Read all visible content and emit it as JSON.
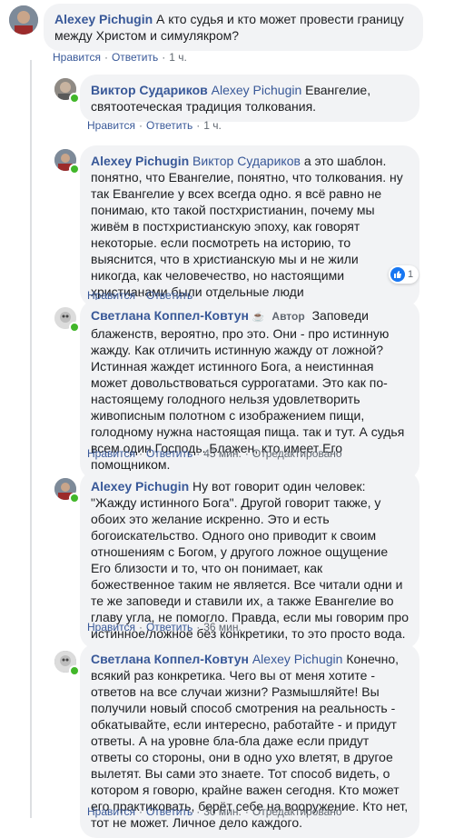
{
  "comments": [
    {
      "author": "Alexey Pichugin",
      "text": "А кто судья и кто может провести границу между Христом и симулякром?",
      "like": "Нравится",
      "reply": "Ответить",
      "time": "1 ч."
    },
    {
      "author": "Виктор Судариков",
      "mention": "Alexey Pichugin",
      "text": "Евангелие, святоотеческая традиция толкования.",
      "like": "Нравится",
      "reply": "Ответить",
      "time": "1 ч."
    },
    {
      "author": "Alexey Pichugin",
      "mention": "Виктор Судариков",
      "text": "а это шаблон. понятно, что Евангелие, понятно, что толкования. ну так Евангелие у всех всегда одно. я всё равно не понимаю, кто такой постхристианин, почему мы живём в постхристианскую эпоху, как говорят некоторые. если посмотреть на историю, то выяснится, что в христианскую мы и не жили никогда, как человечество, но настоящими христианами были отдельные люди",
      "reaction_count": "1",
      "like": "Нравится",
      "reply": "Ответить",
      "time": ""
    },
    {
      "author": "Светлана Коппел-Ковтун",
      "badge": "Автор",
      "text": "Заповеди блаженств, вероятно, про это. Они - про истинную жажду. Как отличить истинную жажду от ложной? Истинная жаждет истинного Бога, а неистинная может довольствоваться суррогатами. Это как по-настоящему голодного нельзя удовлетворить живописным полотном с изображением пищи, голодному нужна настоящая пища. так и тут. А судья всем один Господь. Блажен, кто имеет Его помощником.",
      "like": "Нравится",
      "reply": "Ответить",
      "time": "45 мин.",
      "edited": "Отредактировано"
    },
    {
      "author": "Alexey Pichugin",
      "text": "Ну вот говорит один человек: \"Жажду истинного Бога\". Другой говорит также, у обоих это желание искренно. Это и есть богоискательство. Одного оно приводит к своим отношениям с Богом, у другого ложное ощущение Его близости и то, что он понимает, как божественное таким не является. Все читали одни и те же заповеди и ставили их, а также Евангелие во главу угла, не помогло. Правда, если мы говорим про истинное/ложное без конкретики, то это просто вода.",
      "like": "Нравится",
      "reply": "Ответить",
      "time": "36 мин."
    },
    {
      "author": "Светлана Коппел-Ковтун",
      "mention": "Alexey Pichugin",
      "text": "Конечно, всякий раз конкретика. Чего вы от меня хотите - ответов на все случаи жизни? Размышляйте! Вы получили новый способ смотрения на реальность - обкатывайте, если интересно, работайте - и придут ответы. А на уровне бла-бла даже если придут ответы со стороны, они в одно ухо влетят, в другое вылетят. Вы сами это знаете. Тот способ видеть, о котором я говорю, крайне важен сегодня. Кто может его практиковать, берёт себе на вооружение. Кто нет, тот не может. Личное дело каждого.",
      "like": "Нравится",
      "reply": "Ответить",
      "time": "30 мин.",
      "edited": "Отредактировано"
    }
  ],
  "icons": {
    "online": "online-dot",
    "like": "thumbs-up-icon",
    "mug": "mug-icon"
  },
  "colors": {
    "link": "#385898",
    "bubble": "#f2f3f5",
    "online": "#42b72a",
    "like": "#1877f2"
  }
}
